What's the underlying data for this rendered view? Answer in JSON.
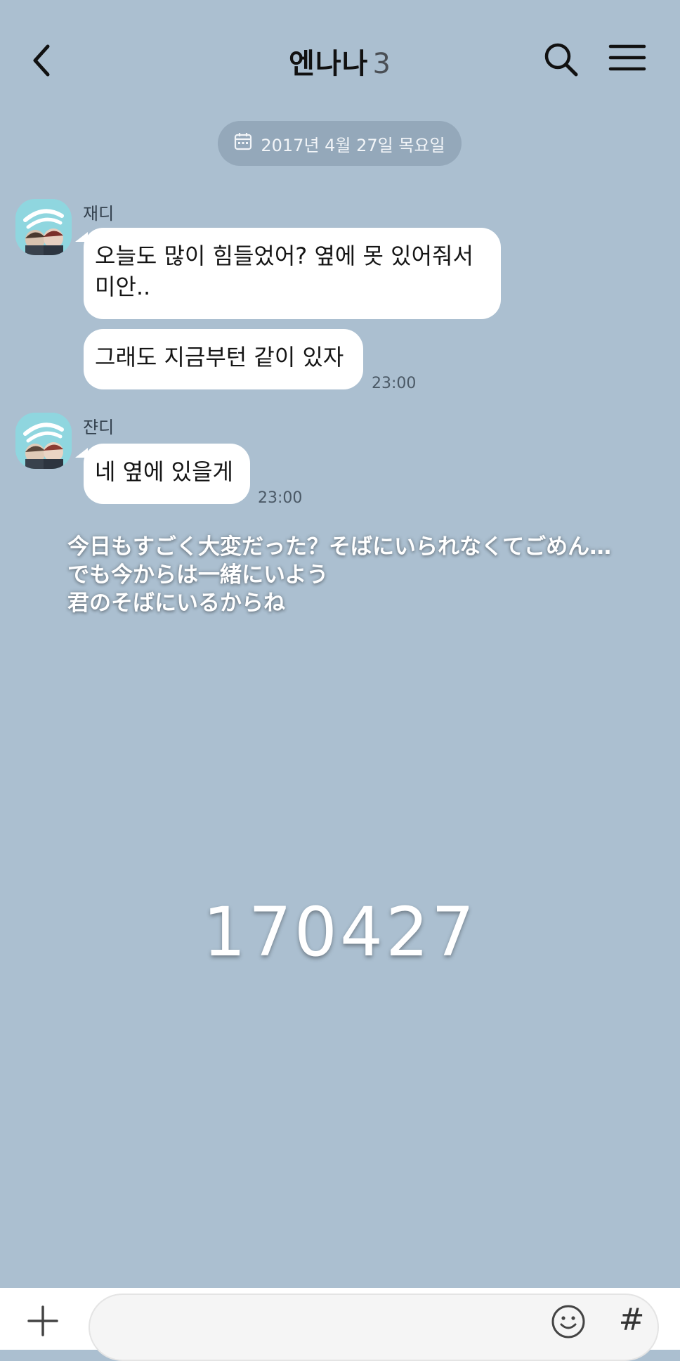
{
  "header": {
    "title": "엔나나",
    "member_count": "3",
    "back_icon": "chevron-left-icon",
    "search_icon": "search-icon",
    "menu_icon": "hamburger-menu-icon"
  },
  "date_divider": {
    "icon": "calendar-icon",
    "text": "2017년 4월 27일 목요일"
  },
  "messages": [
    {
      "sender": "재디",
      "avatar_icon": "night-night-avatar",
      "bubbles": [
        "오늘도 많이 힘들었어? 옆에 못 있어줘서\n미안..",
        "그래도 지금부턴 같이 있자"
      ],
      "time": "23:00"
    },
    {
      "sender": "쟌디",
      "avatar_icon": "night-night-avatar",
      "bubbles": [
        "네 옆에 있을게"
      ],
      "time": "23:00"
    }
  ],
  "overlay": {
    "caption": "今日もすごく大変だった？そばにいられなくてごめん…\nでも今からは一緒にいよう\n君のそばにいるからね",
    "date_code": "170427"
  },
  "input_bar": {
    "plus_icon": "plus-icon",
    "emoji_icon": "emoji-icon",
    "hash_label": "#",
    "placeholder": ""
  },
  "colors": {
    "background": "#abbfd0",
    "bubble": "#ffffff",
    "avatar_bg": "#8fd6df",
    "input_bar": "#ffffff"
  }
}
